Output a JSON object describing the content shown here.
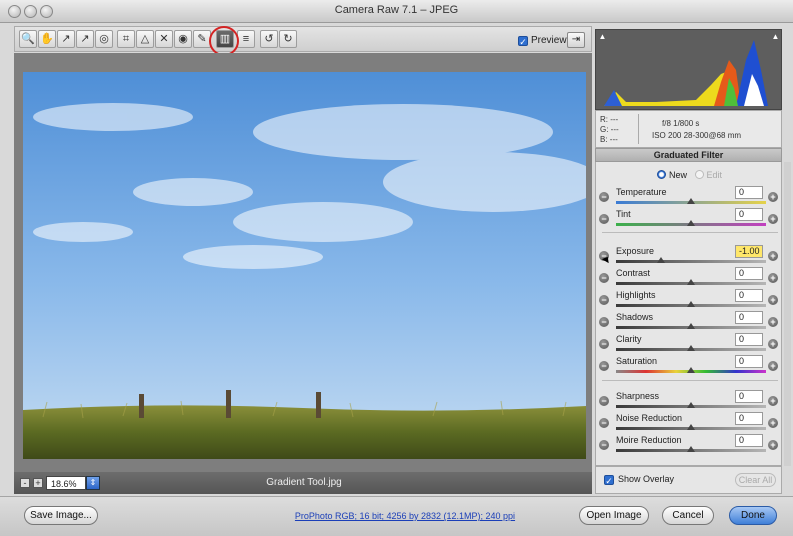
{
  "window": {
    "title": "Camera Raw 7.1  –  JPEG"
  },
  "toolbar": {
    "tools": [
      {
        "icon": "zoom-icon",
        "glyph": "🔍"
      },
      {
        "icon": "hand-icon",
        "glyph": "✋"
      },
      {
        "icon": "white-balance-icon",
        "glyph": "↗"
      },
      {
        "icon": "color-sampler-icon",
        "glyph": "↗"
      },
      {
        "icon": "targeted-adjustment-icon",
        "glyph": "◎"
      },
      {
        "icon": "crop-icon",
        "glyph": "⌗"
      },
      {
        "icon": "straighten-icon",
        "glyph": "△"
      },
      {
        "icon": "spot-removal-icon",
        "glyph": "✕"
      },
      {
        "icon": "red-eye-icon",
        "glyph": "◉"
      },
      {
        "icon": "adjustment-brush-icon",
        "glyph": "✎"
      },
      {
        "icon": "graduated-filter-icon",
        "glyph": "▥"
      },
      {
        "icon": "preferences-icon",
        "glyph": "≡"
      },
      {
        "icon": "rotate-ccw-icon",
        "glyph": "↺"
      },
      {
        "icon": "rotate-cw-icon",
        "glyph": "↻"
      }
    ],
    "preview_label": "Preview"
  },
  "status": {
    "zoom": "18.6%",
    "filename": "Gradient Tool.jpg"
  },
  "exif": {
    "r": "R: ---",
    "g": "G: ---",
    "b": "B: ---",
    "aperture_shutter": "f/8   1/800 s",
    "iso_lens": "ISO 200   28-300@68 mm"
  },
  "panel": {
    "title": "Graduated Filter",
    "mode_new": "New",
    "mode_edit": "Edit",
    "sliders": [
      {
        "label": "Temperature",
        "value": "0",
        "pos": 0.5,
        "highlight": false,
        "track": "temp"
      },
      {
        "label": "Tint",
        "value": "0",
        "pos": 0.5,
        "highlight": false,
        "track": "tint"
      },
      {
        "label": "Exposure",
        "value": "-1.00",
        "pos": 0.3,
        "highlight": true,
        "track": "plain"
      },
      {
        "label": "Contrast",
        "value": "0",
        "pos": 0.5,
        "highlight": false,
        "track": "plain"
      },
      {
        "label": "Highlights",
        "value": "0",
        "pos": 0.5,
        "highlight": false,
        "track": "plain"
      },
      {
        "label": "Shadows",
        "value": "0",
        "pos": 0.5,
        "highlight": false,
        "track": "plain"
      },
      {
        "label": "Clarity",
        "value": "0",
        "pos": 0.5,
        "highlight": false,
        "track": "plain"
      },
      {
        "label": "Saturation",
        "value": "0",
        "pos": 0.5,
        "highlight": false,
        "track": "sat"
      },
      {
        "label": "Sharpness",
        "value": "0",
        "pos": 0.5,
        "highlight": false,
        "track": "plain"
      },
      {
        "label": "Noise Reduction",
        "value": "0",
        "pos": 0.5,
        "highlight": false,
        "track": "plain"
      },
      {
        "label": "Moire Reduction",
        "value": "0",
        "pos": 0.5,
        "highlight": false,
        "track": "plain"
      }
    ],
    "show_overlay": "Show Overlay",
    "clear_all": "Clear All"
  },
  "bottom": {
    "save_image": "Save Image...",
    "workflow": "ProPhoto RGB; 16 bit; 4256 by 2832 (12.1MP); 240 ppi",
    "open_image": "Open Image",
    "cancel": "Cancel",
    "done": "Done"
  },
  "colors": {
    "accent": "#2f6fd0",
    "highlight_ring": "#d42424",
    "exposure_field": "#ffe76a"
  }
}
